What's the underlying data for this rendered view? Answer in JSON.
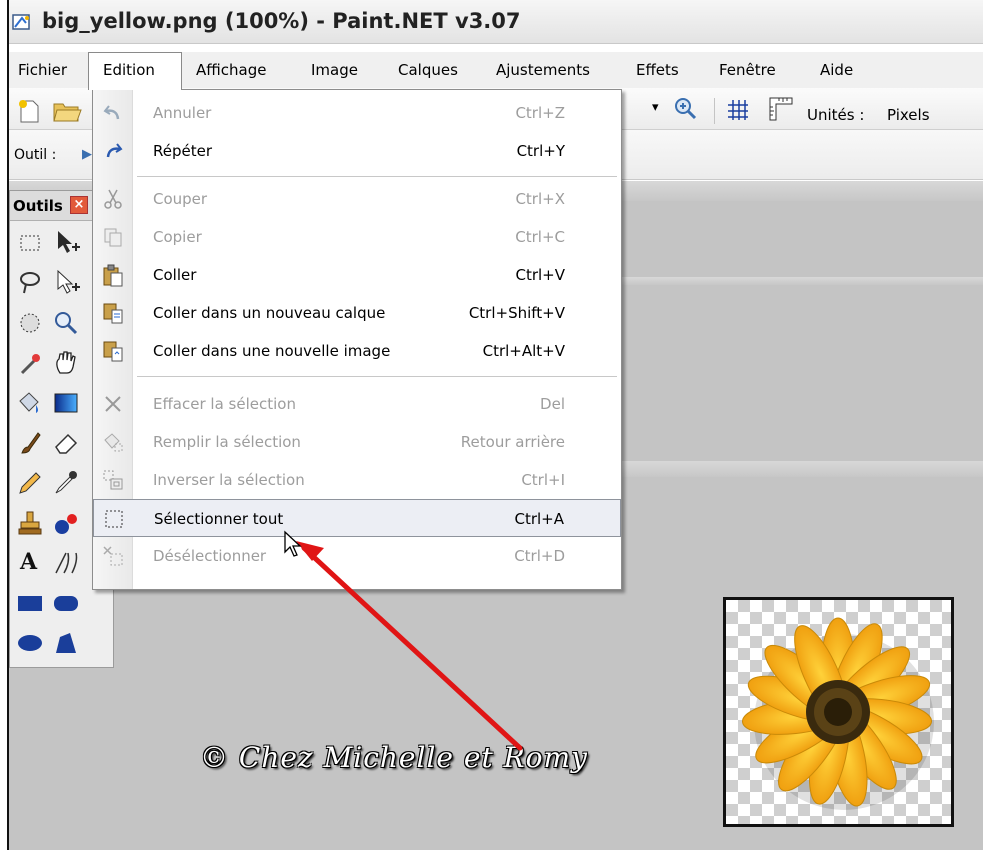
{
  "window": {
    "title": "big_yellow.png (100%) - Paint.NET v3.07"
  },
  "menubar": {
    "items": [
      "Fichier",
      "Edition",
      "Affichage",
      "Image",
      "Calques",
      "Ajustements",
      "Effets",
      "Fenêtre",
      "Aide"
    ],
    "active": "Edition"
  },
  "toolbar": {
    "tool_label": "Outil :",
    "units_label": "Unités :",
    "units_value": "Pixels"
  },
  "tools_panel": {
    "title": "Outils"
  },
  "edit_menu": {
    "items": [
      {
        "label": "Annuler",
        "shortcut": "Ctrl+Z",
        "icon": "undo-icon",
        "enabled": false
      },
      {
        "label": "Répéter",
        "shortcut": "Ctrl+Y",
        "icon": "redo-icon",
        "enabled": true
      },
      {
        "label": "Couper",
        "shortcut": "Ctrl+X",
        "icon": "scissors-icon",
        "enabled": false
      },
      {
        "label": "Copier",
        "shortcut": "Ctrl+C",
        "icon": "copy-icon",
        "enabled": false
      },
      {
        "label": "Coller",
        "shortcut": "Ctrl+V",
        "icon": "paste-icon",
        "enabled": true
      },
      {
        "label": "Coller dans un nouveau calque",
        "shortcut": "Ctrl+Shift+V",
        "icon": "paste-new-layer-icon",
        "enabled": true
      },
      {
        "label": "Coller dans une nouvelle image",
        "shortcut": "Ctrl+Alt+V",
        "icon": "paste-new-image-icon",
        "enabled": true
      },
      {
        "label": "Effacer la sélection",
        "shortcut": "Del",
        "icon": "erase-selection-icon",
        "enabled": false
      },
      {
        "label": "Remplir la sélection",
        "shortcut": "Retour arrière",
        "icon": "fill-selection-icon",
        "enabled": false
      },
      {
        "label": "Inverser la sélection",
        "shortcut": "Ctrl+I",
        "icon": "invert-selection-icon",
        "enabled": false
      },
      {
        "label": "Sélectionner tout",
        "shortcut": "Ctrl+A",
        "icon": "select-all-icon",
        "enabled": true,
        "highlighted": true
      },
      {
        "label": "Désélectionner",
        "shortcut": "Ctrl+D",
        "icon": "deselect-icon",
        "enabled": false
      }
    ]
  },
  "watermark": "© Chez Michelle et Romy",
  "colors": {
    "workspace": "#c4c4c4",
    "annotation_arrow": "#e01515",
    "disabled_text": "#9d9d9d"
  }
}
